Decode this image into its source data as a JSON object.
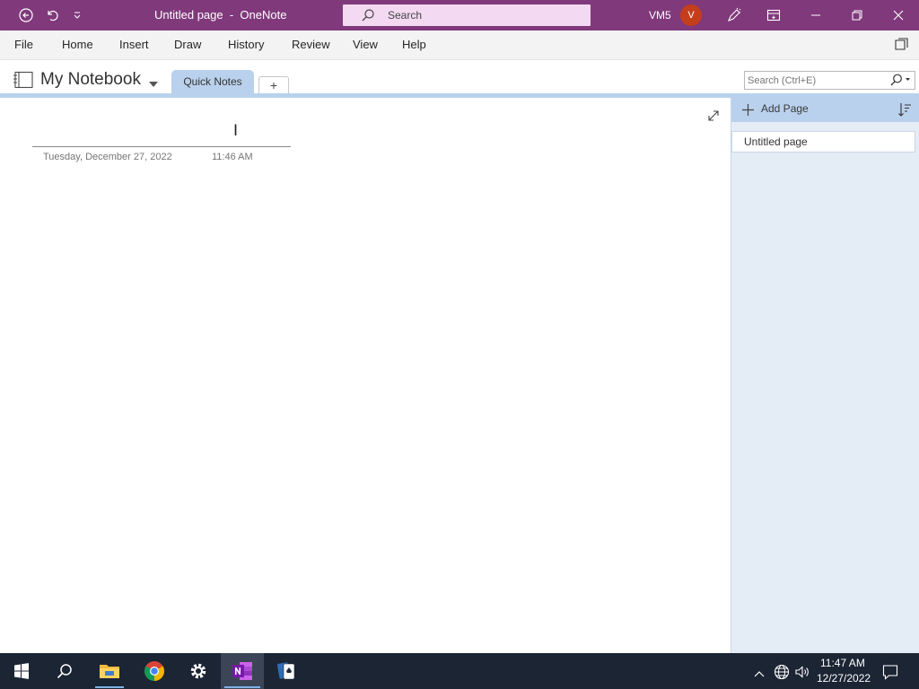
{
  "titlebar": {
    "doc_title": "Untitled page  -  OneNote",
    "search_placeholder": "Search",
    "user_initials": "VM5",
    "avatar_letter": "V",
    "background": "#80397b",
    "icons": [
      "back-icon",
      "undo-icon",
      "customize-qat-icon",
      "coauthor-pen-icon",
      "ribbon-display-icon",
      "minimize-icon",
      "restore-icon",
      "close-icon"
    ]
  },
  "menu": {
    "items": [
      "File",
      "Home",
      "Insert",
      "Draw",
      "History",
      "Review",
      "View",
      "Help"
    ]
  },
  "notebook": {
    "name": "My Notebook",
    "section_tab": "Quick Notes",
    "add_section": "+",
    "search_placeholder": "Search (Ctrl+E)"
  },
  "page": {
    "title_value": "",
    "date": "Tuesday, December 27, 2022",
    "time": "11:46 AM"
  },
  "pagelist": {
    "add_page": "Add Page",
    "pages": [
      "Untitled page"
    ]
  },
  "taskbar": {
    "apps": [
      "windows-start-icon",
      "search-icon",
      "file-explorer-icon",
      "chrome-icon",
      "settings-icon",
      "onenote-icon",
      "solitaire-icon"
    ],
    "clock_time": "11:47 AM",
    "clock_date": "12/27/2022"
  },
  "colors": {
    "accent": "#80397b",
    "section": "#b9d1ec",
    "pagelist_bg": "#e4ecf6",
    "taskbar": "#1c2534"
  }
}
